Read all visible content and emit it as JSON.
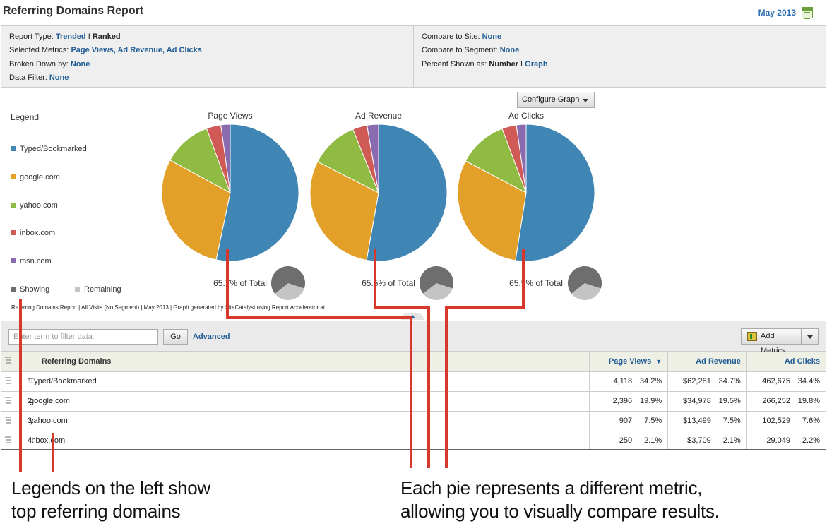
{
  "header": {
    "title": "Referring Domains Report",
    "date": "May 2013",
    "calendar_icon": "calendar-icon"
  },
  "settings": {
    "left": [
      {
        "label": "Report Type:",
        "values": [
          {
            "text": "Trended",
            "link": true
          },
          {
            "text": " I ",
            "link": false
          },
          {
            "text": "Ranked",
            "link": false,
            "bold": true
          }
        ]
      },
      {
        "label": "Selected Metrics:",
        "values": [
          {
            "text": "Page Views, Ad Revenue, Ad Clicks",
            "link": true
          }
        ]
      },
      {
        "label": "Broken Down by:",
        "values": [
          {
            "text": "None",
            "link": true
          }
        ]
      },
      {
        "label": "Data Filter:",
        "values": [
          {
            "text": "None",
            "link": true
          }
        ]
      }
    ],
    "right": [
      {
        "label": "Compare to Site:",
        "values": [
          {
            "text": "None",
            "link": true
          }
        ]
      },
      {
        "label": "Compare to Segment:",
        "values": [
          {
            "text": "None",
            "link": true
          }
        ]
      },
      {
        "label": "Percent Shown as:",
        "values": [
          {
            "text": "Number",
            "link": false,
            "bold": true
          },
          {
            "text": " I ",
            "link": false
          },
          {
            "text": "Graph",
            "link": true
          }
        ]
      }
    ]
  },
  "graph": {
    "configure_label": "Configure Graph",
    "legend_title": "Legend",
    "legend": [
      {
        "label": "Typed/Bookmarked",
        "color": "#3f86b4"
      },
      {
        "label": "google.com",
        "color": "#e3a029"
      },
      {
        "label": "yahoo.com",
        "color": "#8fbb43"
      },
      {
        "label": "inbox.com",
        "color": "#d05a55"
      },
      {
        "label": "msn.com",
        "color": "#8a6bb0"
      }
    ],
    "legend_showing": {
      "label": "Showing",
      "color": "#6e6e6e"
    },
    "legend_remaining": {
      "label": "Remaining",
      "color": "#c4c4c4"
    },
    "footnote": "Referring Domains Report | All Visits (No Segment) | May 2013 | Graph generated by SiteCatalyst using Report Accelerator at .."
  },
  "chart_data": [
    {
      "type": "pie",
      "title": "Page Views",
      "categories": [
        "Typed/Bookmarked",
        "google.com",
        "yahoo.com",
        "inbox.com",
        "msn.com"
      ],
      "values": [
        53.3,
        29.6,
        11.5,
        3.4,
        2.2
      ],
      "total_label": "65.7% of Total",
      "total_fraction": 0.657
    },
    {
      "type": "pie",
      "title": "Ad Revenue",
      "categories": [
        "Typed/Bookmarked",
        "google.com",
        "yahoo.com",
        "inbox.com",
        "msn.com"
      ],
      "values": [
        52.8,
        29.7,
        11.4,
        3.4,
        2.7
      ],
      "total_label": "65.5% of Total",
      "total_fraction": 0.655
    },
    {
      "type": "pie",
      "title": "Ad Clicks",
      "categories": [
        "Typed/Bookmarked",
        "google.com",
        "yahoo.com",
        "inbox.com",
        "msn.com"
      ],
      "values": [
        52.5,
        30.2,
        11.6,
        3.4,
        2.3
      ],
      "total_label": "65.5% of Total",
      "total_fraction": 0.655
    }
  ],
  "filter": {
    "placeholder": "Enter term to filter data",
    "go_label": "Go",
    "advanced_label": "Advanced",
    "add_metrics_label": "Add Metrics"
  },
  "table": {
    "headers": {
      "domain": "Referring Domains",
      "page_views": "Page Views",
      "ad_revenue": "Ad Revenue",
      "ad_clicks": "Ad Clicks",
      "sort_indicator": "▼"
    },
    "rows": [
      {
        "rank": "1.",
        "domain": "Typed/Bookmarked",
        "page_views": "4,118",
        "page_views_pct": "34.2%",
        "ad_revenue": "$62,281",
        "ad_revenue_pct": "34.7%",
        "ad_clicks": "462,675",
        "ad_clicks_pct": "34.4%"
      },
      {
        "rank": "2.",
        "domain": "google.com",
        "page_views": "2,396",
        "page_views_pct": "19.9%",
        "ad_revenue": "$34,978",
        "ad_revenue_pct": "19.5%",
        "ad_clicks": "266,252",
        "ad_clicks_pct": "19.8%"
      },
      {
        "rank": "3.",
        "domain": "yahoo.com",
        "page_views": "907",
        "page_views_pct": "7.5%",
        "ad_revenue": "$13,499",
        "ad_revenue_pct": "7.5%",
        "ad_clicks": "102,529",
        "ad_clicks_pct": "7.6%"
      },
      {
        "rank": "4.",
        "domain": "inbox.com",
        "page_views": "250",
        "page_views_pct": "2.1%",
        "ad_revenue": "$3,709",
        "ad_revenue_pct": "2.1%",
        "ad_clicks": "29,049",
        "ad_clicks_pct": "2.2%"
      }
    ]
  },
  "annotations": {
    "color": "#d6382c",
    "left_caption_line1": "Legends on the left show",
    "left_caption_line2": "top referring domains",
    "right_caption_line1": "Each pie represents a different metric,",
    "right_caption_line2": "allowing you to visually compare results."
  }
}
